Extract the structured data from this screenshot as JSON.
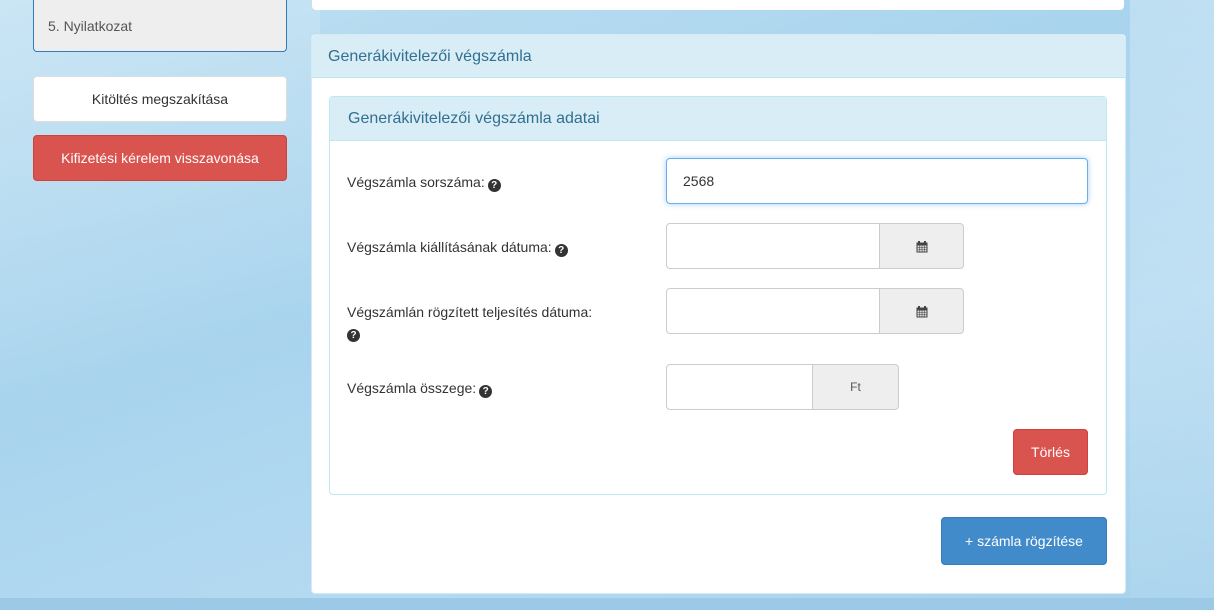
{
  "sidebar": {
    "step_label": "5. Nyilatkozat",
    "abort_label": "Kitöltés megszakítása",
    "withdraw_label": "Kifizetési kérelem visszavonása"
  },
  "panel": {
    "title": "Generákivitelezői végszámla",
    "sub_title": "Generákivitelezői végszámla adatai"
  },
  "form": {
    "invoice_number_label": "Végszámla sorszáma:",
    "invoice_number_value": "2568",
    "issue_date_label": "Végszámla kiállításának dátuma:",
    "completion_date_label": "Végszámlán rögzített teljesítés dátuma:",
    "amount_label": "Végszámla összege:",
    "currency": "Ft",
    "help_glyph": "?"
  },
  "buttons": {
    "delete_label": "Törlés",
    "add_invoice_label": "+ számla rögzítése"
  },
  "icons": {
    "help": "question-circle-icon",
    "calendar": "calendar-icon"
  },
  "colors": {
    "danger": "#d9534f",
    "primary": "#428bca",
    "info_heading_bg": "#d9edf7",
    "info_heading_text": "#31708f"
  }
}
